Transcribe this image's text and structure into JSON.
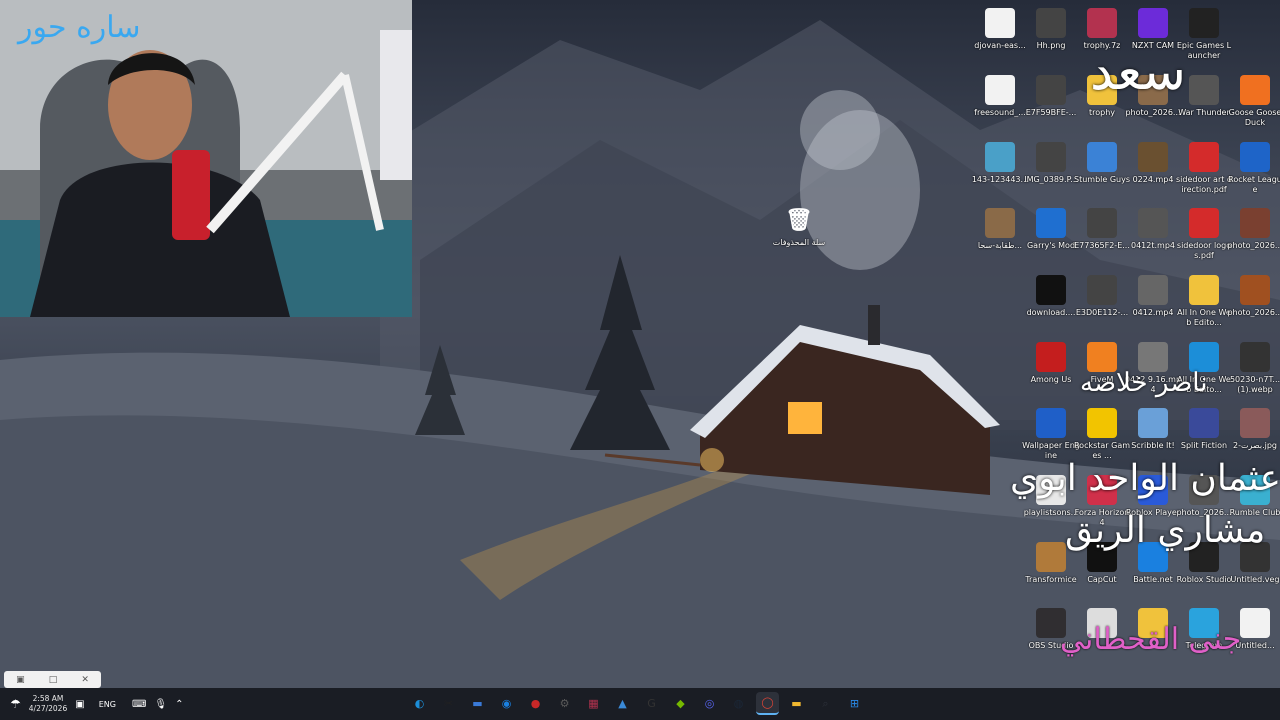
{
  "webcam": {
    "overlay_name": "ساره حور"
  },
  "recycle_bin": {
    "label": "سلة المحذوفات"
  },
  "desktop_icons": [
    {
      "label": "djovan-eas...",
      "icon": "media-file-icon",
      "color": "#f2f2f2"
    },
    {
      "label": "Hh.png",
      "icon": "image-file-icon",
      "color": "#444"
    },
    {
      "label": "trophy.7z",
      "icon": "winrar-archive-icon",
      "color": "#b3324f"
    },
    {
      "label": "NZXT CAM",
      "icon": "nzxt-icon",
      "color": "#6c2bd9"
    },
    {
      "label": "Epic Games Launcher",
      "icon": "epic-games-icon",
      "color": "#222"
    },
    {
      "label": "freesound_...",
      "icon": "media-file-icon",
      "color": "#f2f2f2"
    },
    {
      "label": "E7F59BFE-...",
      "icon": "image-file-icon",
      "color": "#444"
    },
    {
      "label": "trophy",
      "icon": "folder-icon",
      "color": "#f0c23c"
    },
    {
      "label": "photo_2026...",
      "icon": "image-file-icon",
      "color": "#8a6a4a"
    },
    {
      "label": "War Thunder",
      "icon": "war-thunder-icon",
      "color": "#555"
    },
    {
      "label": "Goose Goose Duck",
      "icon": "goose-goose-duck-icon",
      "color": "#f07020"
    },
    {
      "label": "143-123443...",
      "icon": "image-file-icon",
      "color": "#4aa0c8"
    },
    {
      "label": "IMG_0389.P...",
      "icon": "image-file-icon",
      "color": "#444"
    },
    {
      "label": "Stumble Guys",
      "icon": "stumble-guys-icon",
      "color": "#3b82d6"
    },
    {
      "label": "0224.mp4",
      "icon": "video-file-icon",
      "color": "#6a5030"
    },
    {
      "label": "sidedoor art direction.pdf",
      "icon": "pdf-file-icon",
      "color": "#d42b2b"
    },
    {
      "label": "Rocket League",
      "icon": "rocket-league-icon",
      "color": "#1e64c8"
    },
    {
      "label": "طقابة-سحا...",
      "icon": "image-file-icon",
      "color": "#8a6a48"
    },
    {
      "label": "Garry's Mod",
      "icon": "garrys-mod-icon",
      "color": "#1f6fd0"
    },
    {
      "label": "E77365F2-E...",
      "icon": "image-file-icon",
      "color": "#444"
    },
    {
      "label": "0412t.mp4",
      "icon": "video-file-icon",
      "color": "#555"
    },
    {
      "label": "sidedoor logos.pdf",
      "icon": "pdf-file-icon",
      "color": "#d42b2b"
    },
    {
      "label": "photo_2026...",
      "icon": "image-file-icon",
      "color": "#7a4030"
    },
    {
      "label": "download....",
      "icon": "image-file-icon",
      "color": "#111"
    },
    {
      "label": "E3D0E112-...",
      "icon": "image-file-icon",
      "color": "#444"
    },
    {
      "label": "0412.mp4",
      "icon": "video-file-icon",
      "color": "#666"
    },
    {
      "label": "All In One Web Edito...",
      "icon": "folder-icon",
      "color": "#f0c23c"
    },
    {
      "label": "photo_2026...",
      "icon": "image-file-icon",
      "color": "#a05020"
    },
    {
      "label": "Among Us",
      "icon": "among-us-icon",
      "color": "#c41e1e"
    },
    {
      "label": "FiveM",
      "icon": "fivem-icon",
      "color": "#f08020"
    },
    {
      "label": "0412 9.16.mp4",
      "icon": "video-file-icon",
      "color": "#777"
    },
    {
      "label": "All In One Web Edito...",
      "icon": "edge-icon",
      "color": "#1c8ed8"
    },
    {
      "label": "50230-n7T... (1).webp",
      "icon": "image-file-icon",
      "color": "#333"
    },
    {
      "label": "Wallpaper Engine",
      "icon": "wallpaper-engine-icon",
      "color": "#1f5fc8"
    },
    {
      "label": "Rockstar Games ...",
      "icon": "rockstar-icon",
      "color": "#f2c400"
    },
    {
      "label": "Scribble It!",
      "icon": "scribble-it-icon",
      "color": "#6aa0d8"
    },
    {
      "label": "Split Fiction",
      "icon": "split-fiction-icon",
      "color": "#3a4a9a"
    },
    {
      "label": "2-بصرت.jpg",
      "icon": "image-file-icon",
      "color": "#8a5a5a"
    },
    {
      "label": "playlistsons...",
      "icon": "document-file-icon",
      "color": "#e8e8e8"
    },
    {
      "label": "Forza Horizon 4",
      "icon": "forza-icon",
      "color": "#d0304a"
    },
    {
      "label": "Roblox Player",
      "icon": "roblox-icon",
      "color": "#2a5ad8"
    },
    {
      "label": "photo_2026...",
      "icon": "image-file-icon",
      "color": "#555"
    },
    {
      "label": "Rumble Club",
      "icon": "rumble-club-icon",
      "color": "#3ab0d0"
    },
    {
      "label": "Transformice",
      "icon": "transformice-icon",
      "color": "#b07a3a"
    },
    {
      "label": "CapCut",
      "icon": "capcut-icon",
      "color": "#111"
    },
    {
      "label": "Battle.net",
      "icon": "battlenet-icon",
      "color": "#1a80e0"
    },
    {
      "label": "Roblox Studio",
      "icon": "roblox-studio-icon",
      "color": "#222"
    },
    {
      "label": "Untitled.veg",
      "icon": "vegas-file-icon",
      "color": "#333"
    },
    {
      "label": "OBS Studio",
      "icon": "obs-icon",
      "color": "#302e31"
    },
    {
      "label": "",
      "icon": "document-file-icon",
      "color": "#ddd"
    },
    {
      "label": "",
      "icon": "folder-icon",
      "color": "#f0c23c"
    },
    {
      "label": "Telegram",
      "icon": "telegram-icon",
      "color": "#2aa3dd"
    },
    {
      "label": "Untitled...",
      "icon": "document-file-icon",
      "color": "#f2f2f2"
    }
  ],
  "overlays": [
    {
      "text": "سعد",
      "color": "#ffffff"
    },
    {
      "text": "ناصر خلاصه",
      "color": "#ffffff"
    },
    {
      "text": "عثمان الواحد ابوي",
      "color": "#ffffff"
    },
    {
      "text": "مشاري الريق",
      "color": "#ffffff"
    },
    {
      "text": "جنى القحطاني",
      "color": "#e060c8"
    }
  ],
  "taskbar": {
    "time": "2:58 AM",
    "date": "4/27/2026",
    "language": "ENG",
    "apps": [
      {
        "icon": "edge-icon",
        "glyph": "◐",
        "color": "#1c8ed8"
      },
      {
        "icon": "capcut-icon",
        "glyph": "✂",
        "color": "#222"
      },
      {
        "icon": "chat-icon",
        "glyph": "▬",
        "color": "#3a7ad8"
      },
      {
        "icon": "battlenet-icon",
        "glyph": "◉",
        "color": "#1a80e0"
      },
      {
        "icon": "recorder-icon",
        "glyph": "●",
        "color": "#c82828"
      },
      {
        "icon": "settings-icon",
        "glyph": "⚙",
        "color": "#5a5a5a"
      },
      {
        "icon": "winrar-icon",
        "glyph": "▦",
        "color": "#b3324f"
      },
      {
        "icon": "photos-icon",
        "glyph": "▲",
        "color": "#3a8ad8"
      },
      {
        "icon": "g-hub-icon",
        "glyph": "G",
        "color": "#333"
      },
      {
        "icon": "nvidia-icon",
        "glyph": "◆",
        "color": "#76b900"
      },
      {
        "icon": "discord-icon",
        "glyph": "◎",
        "color": "#5865f2"
      },
      {
        "icon": "steam-icon",
        "glyph": "◍",
        "color": "#1b2838"
      },
      {
        "icon": "chrome-icon",
        "glyph": "◯",
        "color": "#db4437"
      },
      {
        "icon": "file-explorer-icon",
        "glyph": "▬",
        "color": "#f0b830"
      },
      {
        "icon": "search-icon",
        "glyph": "⌕",
        "color": "#2d313a"
      },
      {
        "icon": "windows-start-icon",
        "glyph": "⊞",
        "color": "#2a8ae8"
      }
    ]
  }
}
